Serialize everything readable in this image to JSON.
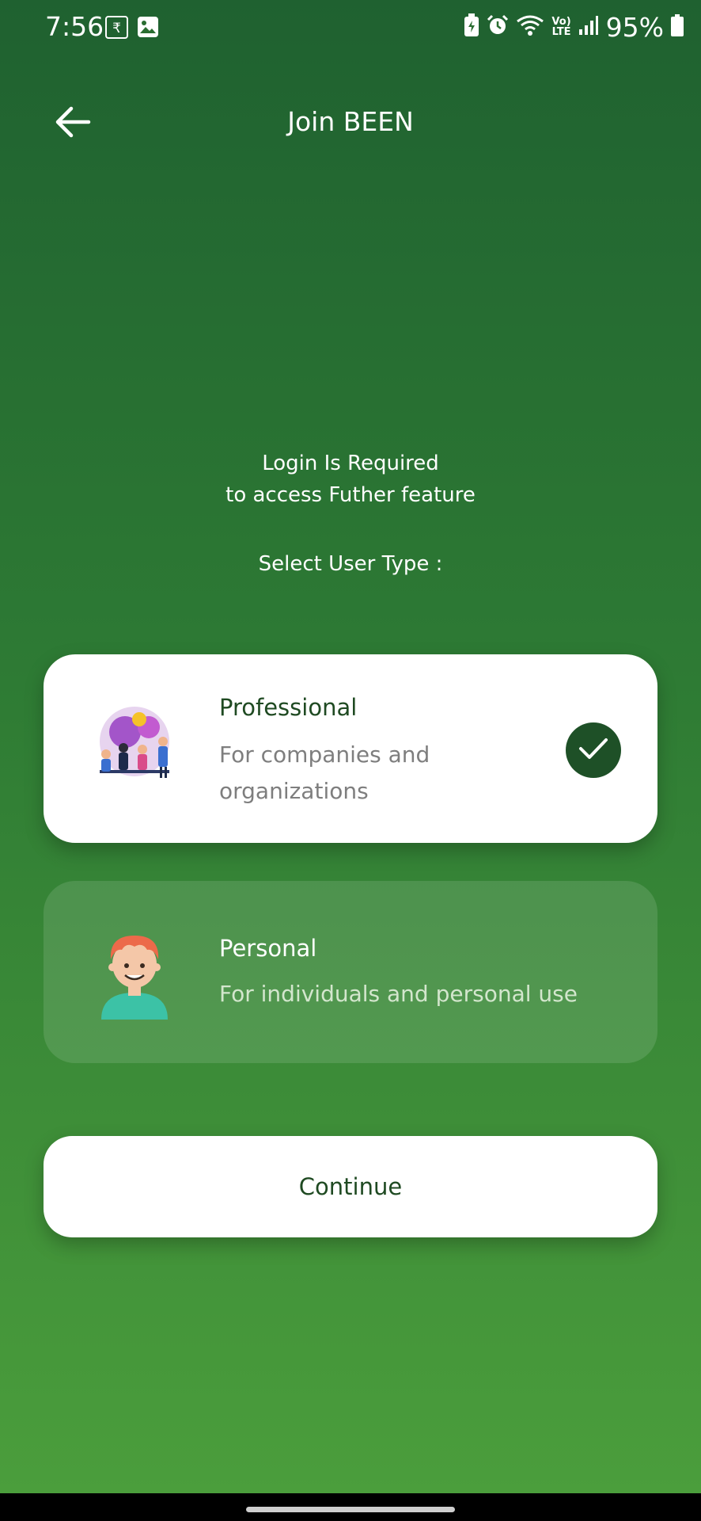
{
  "status_bar": {
    "time": "7:56",
    "rupee_icon": "₹",
    "lte_top": "Vo)",
    "lte_bottom": "LTE",
    "battery_percent": "95%",
    "icons": [
      "rupee-icon",
      "gallery-icon",
      "battery-saver-icon",
      "alarm-icon",
      "wifi-icon",
      "volte-icon",
      "signal-icon",
      "battery-icon"
    ]
  },
  "app_bar": {
    "title": "Join BEEN",
    "back_icon": "arrow-left-icon"
  },
  "info": {
    "line1": "Login Is Required",
    "line2": "to access Futher feature",
    "select_label": "Select User Type :"
  },
  "user_types": [
    {
      "title": "Professional",
      "description": "For companies and organizations",
      "selected": true,
      "icon": "team-illustration-icon"
    },
    {
      "title": "Personal",
      "description": "For individuals and personal use",
      "selected": false,
      "icon": "person-avatar-icon"
    }
  ],
  "continue_label": "Continue",
  "colors": {
    "background_top": "#1f6130",
    "background_bottom": "#4c9f3c",
    "accent_dark": "#1e5027",
    "card_white": "#ffffff"
  }
}
